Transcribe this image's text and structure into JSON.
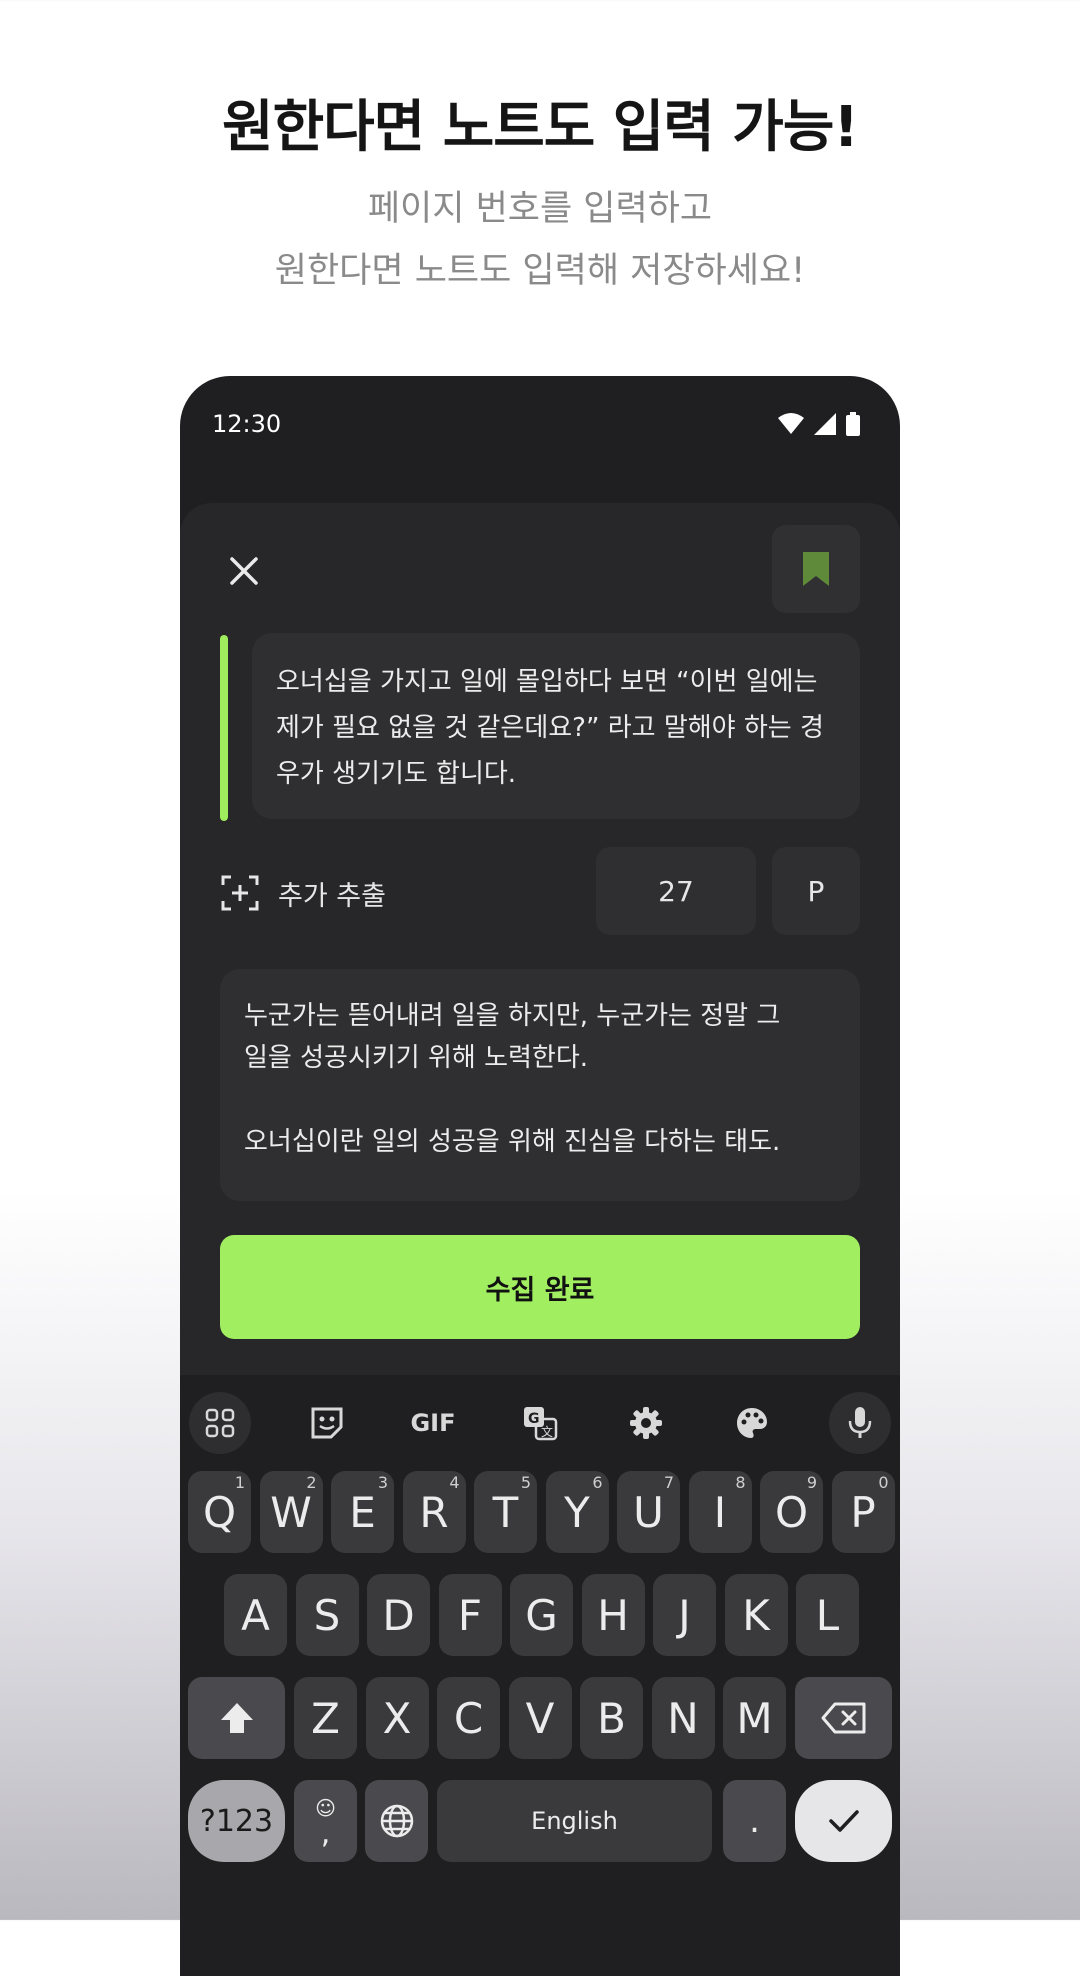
{
  "headline": "원한다면 노트도 입력 가능!",
  "subline": [
    "페이지 번호를 입력하고",
    "원한다면 노트도 입력해 저장하세요!"
  ],
  "status": {
    "time": "12:30"
  },
  "sheet": {
    "quote_lines": [
      "오너십을 가지고 일에 몰입하다 보면 “이번 일에는",
      "제가 필요 없을 것 같은데요?” 라고 말해야 하는 경",
      "우가 생기기도 합니다."
    ],
    "extract_label": "추가 추출",
    "page_number": "27",
    "page_unit": "P",
    "note_lines": [
      "누군가는 뜯어내려 일을 하지만, 누군가는 정말 그",
      "일을 성공시키기 위해 노력한다.",
      "오너십이란 일의 성공을 위해 진심을 다하는 태도."
    ],
    "submit_label": "수집 완료",
    "accent_color": "#a1ef60"
  },
  "keyboard": {
    "toolbar_icons": [
      "apps-grid-icon",
      "sticker-icon",
      "gif-icon",
      "translate-icon",
      "settings-gear-icon",
      "palette-icon",
      "microphone-icon"
    ],
    "gif_label": "GIF",
    "row1": [
      {
        "k": "Q",
        "h": "1"
      },
      {
        "k": "W",
        "h": "2"
      },
      {
        "k": "E",
        "h": "3"
      },
      {
        "k": "R",
        "h": "4"
      },
      {
        "k": "T",
        "h": "5"
      },
      {
        "k": "Y",
        "h": "6"
      },
      {
        "k": "U",
        "h": "7"
      },
      {
        "k": "I",
        "h": "8"
      },
      {
        "k": "O",
        "h": "9"
      },
      {
        "k": "P",
        "h": "0"
      }
    ],
    "row2": [
      "A",
      "S",
      "D",
      "F",
      "G",
      "H",
      "J",
      "K",
      "L"
    ],
    "row3": [
      "Z",
      "X",
      "C",
      "V",
      "B",
      "N",
      "M"
    ],
    "symbols_label": "?123",
    "comma_label": ",",
    "space_label": "English",
    "period_label": "."
  }
}
